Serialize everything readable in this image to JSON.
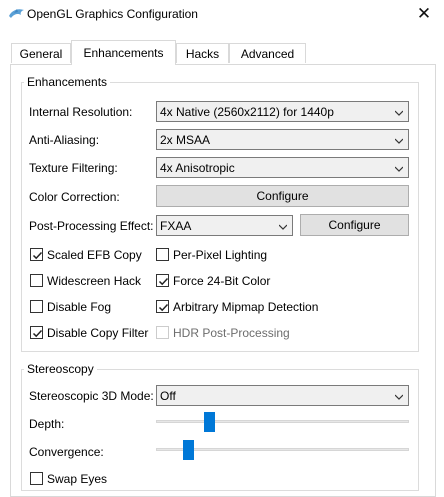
{
  "window": {
    "title": "OpenGL Graphics Configuration",
    "close_glyph": "✕"
  },
  "tabs": [
    {
      "label": "General",
      "active": false
    },
    {
      "label": "Enhancements",
      "active": true
    },
    {
      "label": "Hacks",
      "active": false
    },
    {
      "label": "Advanced",
      "active": false
    }
  ],
  "enhancements": {
    "title": "Enhancements",
    "internal_resolution": {
      "label": "Internal Resolution:",
      "value": "4x Native (2560x2112) for 1440p"
    },
    "anti_aliasing": {
      "label": "Anti-Aliasing:",
      "value": "2x MSAA"
    },
    "texture_filtering": {
      "label": "Texture Filtering:",
      "value": "4x Anisotropic"
    },
    "color_correction": {
      "label": "Color Correction:",
      "button": "Configure"
    },
    "post_processing": {
      "label": "Post-Processing Effect:",
      "value": "FXAA",
      "button": "Configure"
    },
    "checkboxes": {
      "scaled_efb_copy": {
        "label": "Scaled EFB Copy",
        "checked": true
      },
      "per_pixel_lighting": {
        "label": "Per-Pixel Lighting",
        "checked": false
      },
      "widescreen_hack": {
        "label": "Widescreen Hack",
        "checked": false
      },
      "force_24bit_color": {
        "label": "Force 24-Bit Color",
        "checked": true
      },
      "disable_fog": {
        "label": "Disable Fog",
        "checked": false
      },
      "arbitrary_mipmap": {
        "label": "Arbitrary Mipmap Detection",
        "checked": true
      },
      "disable_copy_filter": {
        "label": "Disable Copy Filter",
        "checked": true
      },
      "hdr_post_processing": {
        "label": "HDR Post-Processing",
        "checked": false,
        "enabled": false
      }
    }
  },
  "stereoscopy": {
    "title": "Stereoscopy",
    "mode": {
      "label": "Stereoscopic 3D Mode:",
      "value": "Off"
    },
    "depth": {
      "label": "Depth:",
      "level": 0.2
    },
    "convergence": {
      "label": "Convergence:",
      "level": 0.11
    },
    "swap_eyes": {
      "label": "Swap Eyes",
      "checked": false
    }
  },
  "colors": {
    "accent": "#0078d7",
    "button_bg": "#e1e1e1",
    "combo_bg": "#f0f0f0"
  }
}
